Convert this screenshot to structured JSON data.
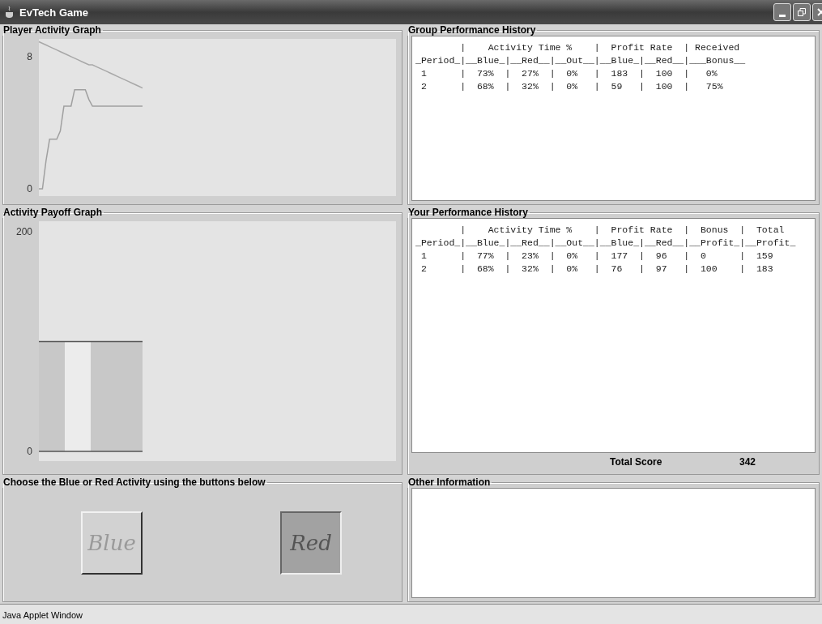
{
  "window": {
    "title": "EvTech Game"
  },
  "player_activity_graph": {
    "title": "Player Activity Graph",
    "chart_data": {
      "type": "line",
      "ylim": [
        -0.44,
        9.07
      ],
      "yticks": [
        {
          "value": 0,
          "label": "0"
        },
        {
          "value": 8,
          "label": "8"
        }
      ],
      "categories": [
        null,
        null,
        null,
        null,
        null,
        null,
        null,
        null,
        null,
        null,
        null,
        null,
        null,
        null,
        null,
        null,
        null,
        null,
        null,
        null,
        null,
        null,
        null,
        null,
        null,
        null,
        null,
        null,
        null,
        null
      ],
      "series": [
        {
          "color": "#a8a8a8",
          "values": [
            8.9,
            8.8,
            8.7,
            8.6,
            8.5,
            8.4,
            8.3,
            8.2,
            8.1,
            8.0,
            7.9,
            7.8,
            7.7,
            7.6,
            7.5,
            7.5,
            7.4,
            7.3,
            7.2,
            7.1,
            7.0,
            6.9,
            6.8,
            6.7,
            6.6,
            6.5,
            6.4,
            6.3,
            6.2,
            6.1
          ]
        },
        {
          "color": "#a0a0a0",
          "values": [
            0,
            0,
            1.7,
            3,
            3,
            3,
            3.5,
            5,
            5,
            5,
            6,
            6,
            6,
            6,
            5.4,
            5,
            5,
            5,
            5,
            5,
            5,
            5,
            5,
            5,
            5,
            5,
            5,
            5,
            5,
            5
          ]
        }
      ]
    }
  },
  "activity_payoff_graph": {
    "title": "Activity Payoff Graph",
    "chart_data": {
      "type": "bar",
      "stacked": true,
      "ylim": [
        -8.9,
        209.6
      ],
      "yticks": [
        {
          "value": 0,
          "label": "0"
        },
        {
          "value": 200,
          "label": "200"
        }
      ],
      "categories": [
        null,
        null,
        null,
        null
      ],
      "series": [
        {
          "color": "#c8c8c8",
          "values": [
            100,
            null,
            100,
            100
          ]
        },
        {
          "color": "#ececec",
          "values": [
            null,
            100,
            null,
            null
          ]
        }
      ]
    }
  },
  "choose_activity": {
    "title": "Choose the Blue or Red Activity using the buttons below",
    "buttons": [
      {
        "label": "Blue",
        "selected": false
      },
      {
        "label": "Red",
        "selected": true
      }
    ]
  },
  "group_performance_history": {
    "title": "Group Performance History",
    "lines": [
      "        |    Activity Time %    |  Profit Rate  | Received",
      "_Period_|__Blue_|__Red__|__Out__|__Blue_|__Red__|___Bonus__",
      " 1      |  73%  |  27%  |  0%   |  183  |  100  |   0%",
      " 2      |  68%  |  32%  |  0%   |  59   |  100  |   75%"
    ]
  },
  "your_performance_history": {
    "title": "Your Performance History",
    "lines": [
      "        |    Activity Time %    |  Profit Rate  |  Bonus  |  Total",
      "_Period_|__Blue_|__Red__|__Out__|__Blue_|__Red__|__Profit_|__Profit_",
      " 1      |  77%  |  23%  |  0%   |  177  |  96   |  0      |  159",
      " 2      |  68%  |  32%  |  0%   |  76   |  97   |  100    |  183"
    ],
    "total_score": {
      "label": "Total Score",
      "value": "342"
    }
  },
  "other_information": {
    "title": "Other Information"
  },
  "status_bar": {
    "text": "Java Applet Window"
  }
}
